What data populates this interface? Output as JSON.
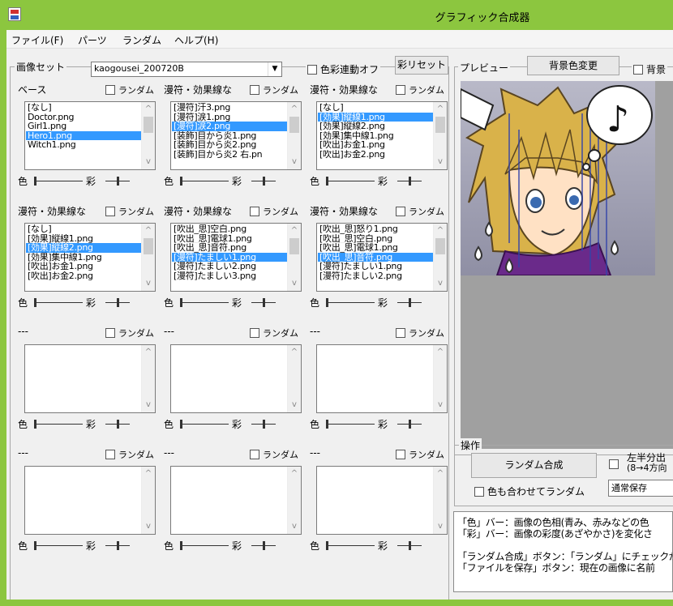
{
  "window": {
    "title": "グラフィック合成器"
  },
  "menu": [
    "ファイル(F)",
    "パーツ",
    "ランダム",
    "ヘルプ(H)"
  ],
  "image_set": {
    "legend": "画像セット",
    "value": "kaogousei_200720B",
    "color_link": "色彩連動オフ",
    "saturation_reset": "彩リセット"
  },
  "preview": {
    "legend": "プレビュー",
    "bg_change": "背景色変更",
    "bg_check": "背景"
  },
  "random_label": "ランダム",
  "color_label": "色",
  "saturation_label": "彩",
  "panels": [
    {
      "title": "ベース",
      "random": "ランダム",
      "items": [
        "[なし]",
        "Doctor.png",
        "Girl1.png",
        "Hero1.png",
        "Witch1.png"
      ],
      "selected": 3
    },
    {
      "title": "漫符・効果線な",
      "random": "ランダム",
      "items": [
        "[漫符]汗3.png",
        "[漫符]涙1.png",
        "[漫符]涙2.png",
        "[装飾]目から炎1.png",
        "[装飾]目から炎2.png",
        "[装飾]目から炎2 右.pn"
      ],
      "selected": 2
    },
    {
      "title": "漫符・効果線な",
      "random": "ランダム",
      "items": [
        "[なし]",
        "[効果]縦線1.png",
        "[効果]縦線2.png",
        "[効果]集中線1.png",
        "[吹出]お金1.png",
        "[吹出]お金2.png"
      ],
      "selected": 1
    },
    {
      "title": "漫符・効果線な",
      "random": "ランダム",
      "items": [
        "[なし]",
        "[効果]縦線1.png",
        "[効果]縦線2.png",
        "[効果]集中線1.png",
        "[吹出]お金1.png",
        "[吹出]お金2.png"
      ],
      "selected": 2
    },
    {
      "title": "漫符・効果線な",
      "random": "ランダム",
      "items": [
        "[吹出_思]空白.png",
        "[吹出_思]電球1.png",
        "[吹出_思]音符.png",
        "[漫符]たましい1.png",
        "[漫符]たましい2.png",
        "[漫符]たましい3.png"
      ],
      "selected": 3
    },
    {
      "title": "漫符・効果線な",
      "random": "ランダム",
      "items": [
        "[吹出_思]怒り1.png",
        "[吹出_思]空白.png",
        "[吹出_思]電球1.png",
        "[吹出_思]音符.png",
        "[漫符]たましい1.png",
        "[漫符]たましい2.png"
      ],
      "selected": 3
    },
    {
      "title": "---",
      "random": "ランダム",
      "items": [],
      "selected": -1
    },
    {
      "title": "---",
      "random": "ランダム",
      "items": [],
      "selected": -1
    },
    {
      "title": "---",
      "random": "ランダム",
      "items": [],
      "selected": -1
    },
    {
      "title": "---",
      "random": "ランダム",
      "items": [],
      "selected": -1
    },
    {
      "title": "---",
      "random": "ランダム",
      "items": [],
      "selected": -1
    },
    {
      "title": "---",
      "random": "ランダム",
      "items": [],
      "selected": -1
    }
  ],
  "operations": {
    "legend": "操作",
    "random_compose": "ランダム合成",
    "split_label_1": "左半分出",
    "split_label_2": "(8→4方向",
    "color_random": "色も合わせてランダム",
    "save_mode": "通常保存"
  },
  "help_lines": [
    "「色」バー：画像の色相(青み、赤みなどの色",
    "「彩」バー：画像の彩度(あざやかさ)を変化さ",
    "「ランダム合成」ボタン：「ランダム」にチェックが",
    "「ファイルを保存」ボタン：現在の画像に名前"
  ],
  "colors": {
    "titlebar": "#8cc63f",
    "selection": "#3399ff",
    "client": "#f0f0f0"
  }
}
